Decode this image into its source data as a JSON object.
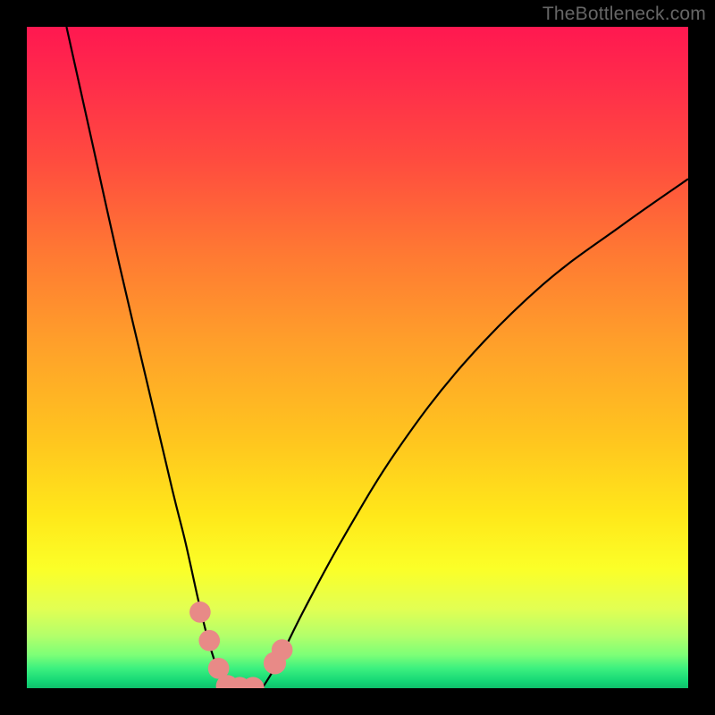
{
  "watermark": "TheBottleneck.com",
  "colors": {
    "frame": "#000000",
    "curve": "#000000",
    "marker": "#e88a87",
    "gradient_stops": [
      {
        "pct": 0,
        "color": "#ff1850"
      },
      {
        "pct": 8,
        "color": "#ff2b4b"
      },
      {
        "pct": 20,
        "color": "#ff4b3f"
      },
      {
        "pct": 34,
        "color": "#ff7833"
      },
      {
        "pct": 48,
        "color": "#ffa02a"
      },
      {
        "pct": 62,
        "color": "#ffc41f"
      },
      {
        "pct": 74,
        "color": "#ffe81a"
      },
      {
        "pct": 82,
        "color": "#fbff28"
      },
      {
        "pct": 88,
        "color": "#e2ff53"
      },
      {
        "pct": 92,
        "color": "#b4ff6a"
      },
      {
        "pct": 95,
        "color": "#7cff77"
      },
      {
        "pct": 97,
        "color": "#3cf07f"
      },
      {
        "pct": 99,
        "color": "#13d675"
      },
      {
        "pct": 100,
        "color": "#0fbf6b"
      }
    ]
  },
  "chart_data": {
    "type": "line",
    "title": "",
    "xlabel": "",
    "ylabel": "",
    "xlim": [
      0,
      100
    ],
    "ylim": [
      0,
      100
    ],
    "series": [
      {
        "name": "left-branch",
        "x": [
          6,
          10,
          14,
          18,
          22,
          24,
          26,
          27.5,
          29,
          30.3
        ],
        "y": [
          100,
          82,
          64,
          47,
          30,
          22,
          13,
          7,
          2.5,
          0
        ]
      },
      {
        "name": "floor",
        "x": [
          30.3,
          32,
          34,
          35.6
        ],
        "y": [
          0,
          0,
          0,
          0
        ]
      },
      {
        "name": "right-branch",
        "x": [
          35.6,
          38,
          42,
          48,
          56,
          66,
          78,
          90,
          100
        ],
        "y": [
          0,
          4,
          12,
          23,
          36,
          49,
          61,
          70,
          77
        ]
      }
    ],
    "markers": [
      {
        "x": 26.2,
        "y": 11.5,
        "r": 1.6
      },
      {
        "x": 27.6,
        "y": 7.2,
        "r": 1.6
      },
      {
        "x": 29.0,
        "y": 3.0,
        "r": 1.6
      },
      {
        "x": 30.3,
        "y": 0.3,
        "r": 1.7
      },
      {
        "x": 32.2,
        "y": 0.0,
        "r": 1.7
      },
      {
        "x": 34.2,
        "y": 0.0,
        "r": 1.7
      },
      {
        "x": 37.5,
        "y": 3.8,
        "r": 1.7
      },
      {
        "x": 38.6,
        "y": 5.8,
        "r": 1.6
      }
    ]
  }
}
